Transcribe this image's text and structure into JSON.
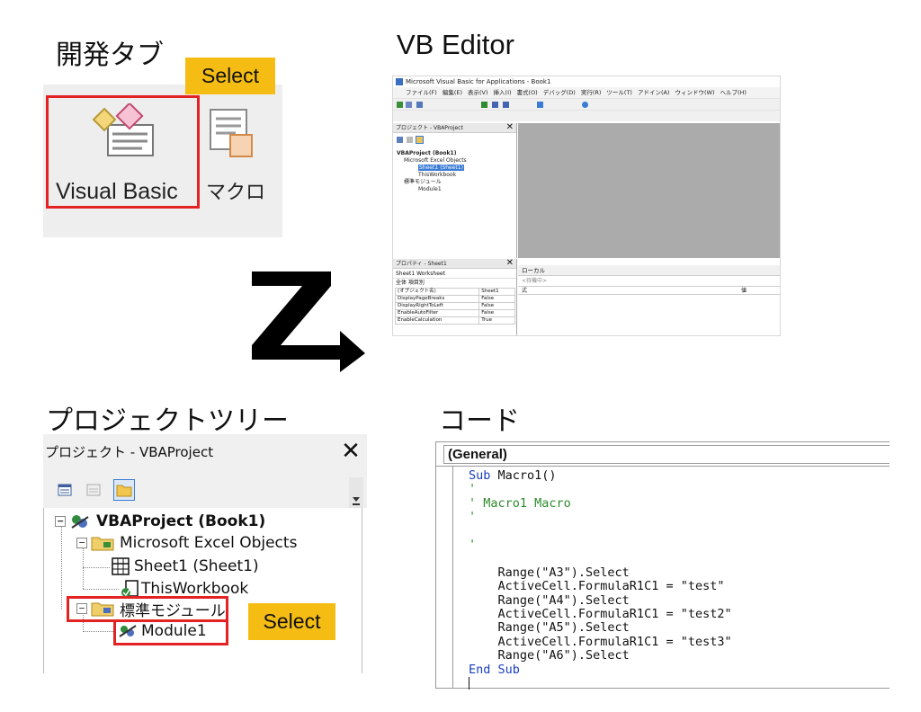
{
  "headings": {
    "developer_tab": "開発タブ",
    "vb_editor": "VB Editor",
    "project_tree": "プロジェクトツリー",
    "code": "コード"
  },
  "select_badge": "Select",
  "ribbon": {
    "visual_basic_label": "Visual Basic",
    "macro_label": "マクロ",
    "highlight_color": "#e32323"
  },
  "vb_editor": {
    "title": "Microsoft Visual Basic for Applications - Book1",
    "menu": [
      "ファイル(F)",
      "編集(E)",
      "表示(V)",
      "挿入(I)",
      "書式(O)",
      "デバッグ(D)",
      "実行(R)",
      "ツール(T)",
      "アドイン(A)",
      "ウィンドウ(W)",
      "ヘルプ(H)"
    ],
    "project_panel_title": "プロジェクト - VBAProject",
    "tree": [
      "VBAProject (Book1)",
      "Microsoft Excel Objects",
      "Sheet1 (Sheet1)",
      "ThisWorkbook",
      "標準モジュール",
      "Module1"
    ],
    "properties_title": "プロパティ - Sheet1",
    "properties_selector": "Sheet1 Worksheet",
    "properties_tabs": "全体  項目別",
    "properties": [
      [
        "(オブジェクト名)",
        "Sheet1"
      ],
      [
        "DisplayPageBreaks",
        "False"
      ],
      [
        "DisplayRightToLeft",
        "False"
      ],
      [
        "EnableAutoFilter",
        "False"
      ],
      [
        "EnableCalculation",
        "True"
      ]
    ],
    "locals_title": "ローカル",
    "locals_status": "<待機中>",
    "locals_col_expr": "式",
    "locals_col_value": "値"
  },
  "project_tree": {
    "title": "プロジェクト - VBAProject",
    "close": "✕",
    "nodes": {
      "root": "VBAProject (Book1)",
      "excel_objects": "Microsoft Excel Objects",
      "sheet1": "Sheet1 (Sheet1)",
      "this_workbook": "ThisWorkbook",
      "std_modules": "標準モジュール",
      "module1": "Module1"
    },
    "expand_symbol": "−"
  },
  "code_window": {
    "object_dropdown": "(General)",
    "lines": {
      "l1_kw": "Sub",
      "l1_rest": " Macro1()",
      "l2": "'",
      "l3": "' Macro1 Macro",
      "l4": "'",
      "l5": "",
      "l6": "'",
      "l7": "",
      "l8": "    Range(\"A3\").Select",
      "l9": "    ActiveCell.FormulaR1C1 = \"test\"",
      "l10": "    Range(\"A4\").Select",
      "l11": "    ActiveCell.FormulaR1C1 = \"test2\"",
      "l12": "    Range(\"A5\").Select",
      "l13": "    ActiveCell.FormulaR1C1 = \"test3\"",
      "l14": "    Range(\"A6\").Select",
      "l15_kw": "End Sub"
    }
  },
  "colors": {
    "select_badge_bg": "#f5bd14",
    "highlight_red": "#e32323",
    "keyword_blue": "#1a3fbf",
    "comment_green": "#2e8b2e",
    "vbe_background_gray": "#ababab"
  }
}
